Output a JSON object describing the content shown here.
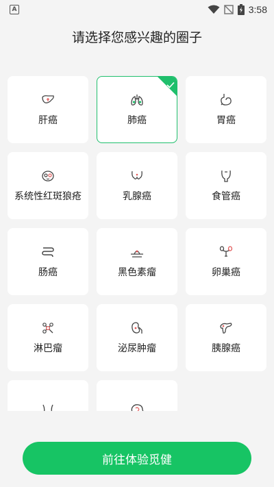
{
  "status_bar": {
    "time": "3:58",
    "app_letter": "A",
    "icons": [
      "wifi-icon",
      "signal-off-icon",
      "battery-charging-icon"
    ]
  },
  "page": {
    "title": "请选择您感兴趣的圈子",
    "cta_label": "前往体验觅健"
  },
  "colors": {
    "accent": "#1fbf6c",
    "button": "#17c464",
    "background": "#f4f4f4",
    "card": "#ffffff"
  },
  "cards": [
    {
      "label": "肝癌",
      "icon": "liver-icon",
      "selected": false
    },
    {
      "label": "肺癌",
      "icon": "lungs-icon",
      "selected": true
    },
    {
      "label": "胃癌",
      "icon": "stomach-icon",
      "selected": false
    },
    {
      "label": "系统性红斑狼疮",
      "icon": "wolf-face-icon",
      "selected": false
    },
    {
      "label": "乳腺癌",
      "icon": "breast-icon",
      "selected": false
    },
    {
      "label": "食管癌",
      "icon": "esophagus-icon",
      "selected": false
    },
    {
      "label": "肠癌",
      "icon": "intestine-icon",
      "selected": false
    },
    {
      "label": "黑色素瘤",
      "icon": "skin-mole-icon",
      "selected": false
    },
    {
      "label": "卵巢癌",
      "icon": "ovary-icon",
      "selected": false
    },
    {
      "label": "淋巴瘤",
      "icon": "lymph-node-icon",
      "selected": false
    },
    {
      "label": "泌尿肿瘤",
      "icon": "kidney-icon",
      "selected": false
    },
    {
      "label": "胰腺癌",
      "icon": "pancreas-icon",
      "selected": false
    },
    {
      "label": "",
      "icon": "pelvis-icon",
      "selected": false
    },
    {
      "label": "",
      "icon": "brain-head-icon",
      "selected": false
    }
  ]
}
